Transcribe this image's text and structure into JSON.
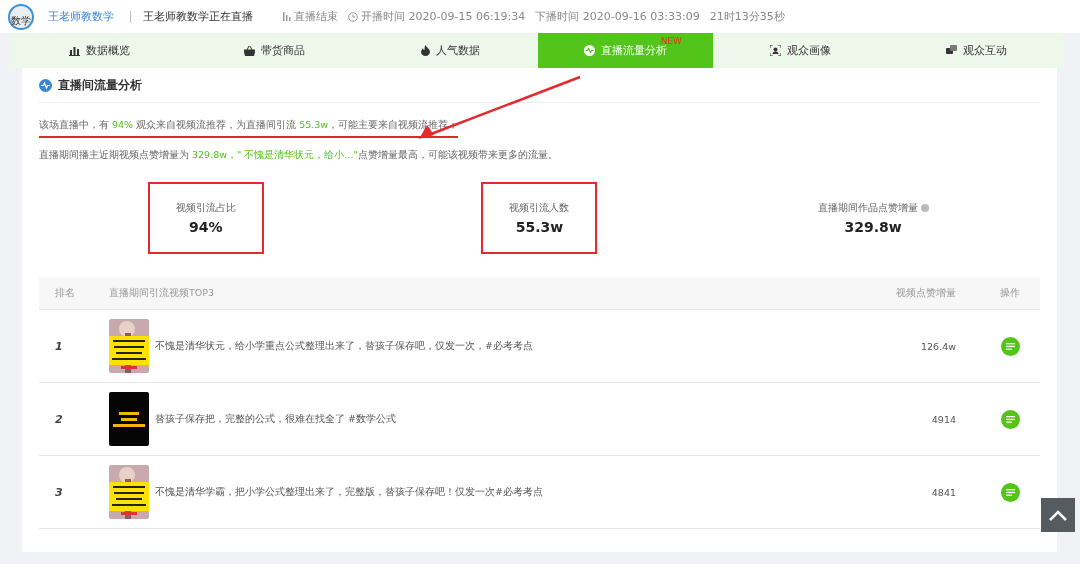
{
  "header": {
    "avatar_text": "数学",
    "account": "王老师教数学",
    "live_title": "王老师教数学正在直播",
    "status": "直播结束",
    "start_time": "开播时间 2020-09-15 06:19:34",
    "end_time": "下播时间 2020-09-16 03:33:09",
    "duration": "21时13分35秒"
  },
  "tabs": [
    {
      "label": "数据概览",
      "selected": false
    },
    {
      "label": "带货商品",
      "selected": false
    },
    {
      "label": "人气数据",
      "selected": false
    },
    {
      "label": "直播流量分析",
      "selected": true,
      "badge": "NEW"
    },
    {
      "label": "观众画像",
      "selected": false
    },
    {
      "label": "观众互动",
      "selected": false
    }
  ],
  "section": {
    "title": "直播间流量分析"
  },
  "summary": [
    {
      "underlined": true,
      "parts": [
        {
          "text": "该场直播中，有 ",
          "green": false
        },
        {
          "text": "94%",
          "green": true
        },
        {
          "text": " 观众来自视频流推荐，为直播间引流 ",
          "green": false
        },
        {
          "text": "55.3w",
          "green": true
        },
        {
          "text": "，可能主要来自视频流推荐；",
          "green": false
        }
      ]
    },
    {
      "underlined": false,
      "parts": [
        {
          "text": "直播期间播主近期视频点赞增量为 ",
          "green": false
        },
        {
          "text": "329.8w",
          "green": true
        },
        {
          "text": "，\"  不愧是清华状元，给小...\"",
          "green": true
        },
        {
          "text": "点赞增量最高，可能该视频带来更多的流量。",
          "green": false
        }
      ]
    }
  ],
  "stats": [
    {
      "label": "视频引流占比",
      "value": "94%",
      "highlighted": true,
      "info": false
    },
    {
      "label": "视频引流人数",
      "value": "55.3w",
      "highlighted": true,
      "info": false
    },
    {
      "label": "直播期间作品点赞增量",
      "value": "329.8w",
      "highlighted": false,
      "info": true
    }
  ],
  "table": {
    "columns": [
      "排名",
      "直播期间引流视频TOP3",
      "视频点赞增量",
      "操作"
    ],
    "rows": [
      {
        "rank": "1",
        "title": "不愧是清华状元，给小学重点公式整理出来了，替孩子保存吧，仅发一次，#必考考点",
        "likes": "126.4w"
      },
      {
        "rank": "2",
        "title": "替孩子保存把，完整的公式，很难在找全了 #数学公式",
        "likes": "4914"
      },
      {
        "rank": "3",
        "title": "不愧是清华学霸，把小学公式整理出来了，完整版，替孩子保存吧！仅发一次#必考考点",
        "likes": "4841"
      }
    ]
  }
}
